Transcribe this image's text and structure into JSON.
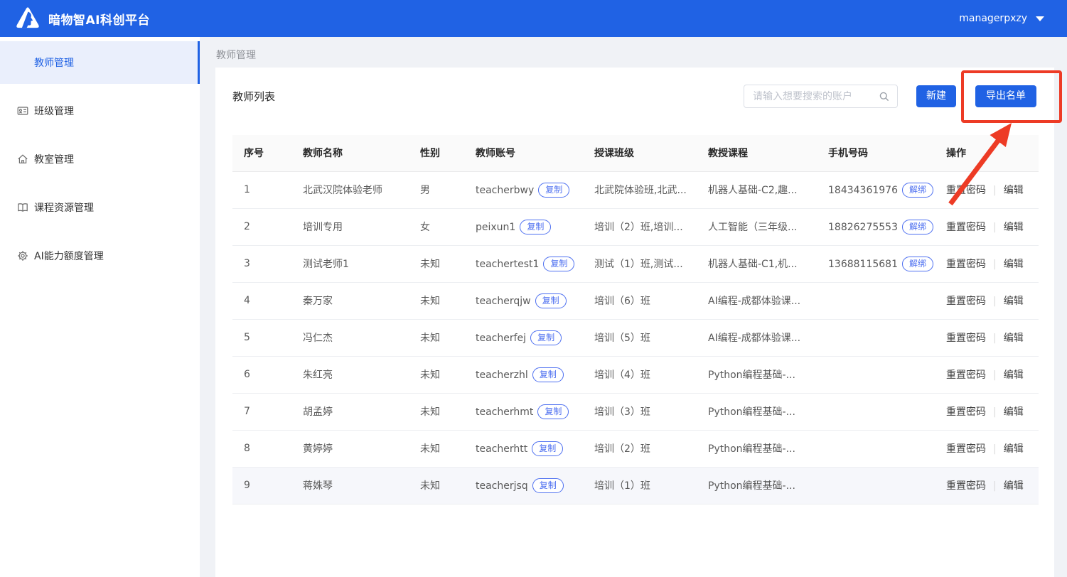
{
  "topbar": {
    "brand": "暗物智AI科创平台",
    "username": "managerpxzy"
  },
  "sidebar": {
    "items": [
      {
        "label": "教师管理",
        "active": true
      },
      {
        "label": "班级管理",
        "active": false
      },
      {
        "label": "教室管理",
        "active": false
      },
      {
        "label": "课程资源管理",
        "active": false
      },
      {
        "label": "AI能力额度管理",
        "active": false
      }
    ]
  },
  "breadcrumb": "教师管理",
  "page": {
    "title": "教师列表",
    "search_placeholder": "请输入想要搜索的账户",
    "new_button": "新建",
    "export_button": "导出名单"
  },
  "table": {
    "columns": [
      "序号",
      "教师名称",
      "性别",
      "教师账号",
      "授课班级",
      "教授课程",
      "手机号码",
      "操作"
    ],
    "copy_label": "复制",
    "unbind_label": "解绑",
    "action_reset": "重置密码",
    "action_edit": "编辑",
    "rows": [
      {
        "no": "1",
        "name": "北武汉院体验老师",
        "gender": "男",
        "account": "teacherbwy",
        "classes": "北武院体验班,北武...",
        "courses": "机器人基础-C2,趣...",
        "phone": "18434361976",
        "highlighted": false
      },
      {
        "no": "2",
        "name": "培训专用",
        "gender": "女",
        "account": "peixun1",
        "classes": "培训（2）班,培训...",
        "courses": "人工智能（三年级...",
        "phone": "18826275553",
        "highlighted": false
      },
      {
        "no": "3",
        "name": "测试老师1",
        "gender": "未知",
        "account": "teachertest1",
        "classes": "测试（1）班,测试...",
        "courses": "机器人基础-C1,机...",
        "phone": "13688115681",
        "highlighted": false
      },
      {
        "no": "4",
        "name": "秦万家",
        "gender": "未知",
        "account": "teacherqjw",
        "classes": "培训（6）班",
        "courses": "AI编程-成都体验课...",
        "phone": "",
        "highlighted": false
      },
      {
        "no": "5",
        "name": "冯仁杰",
        "gender": "未知",
        "account": "teacherfej",
        "classes": "培训（5）班",
        "courses": "AI编程-成都体验课...",
        "phone": "",
        "highlighted": false
      },
      {
        "no": "6",
        "name": "朱红亮",
        "gender": "未知",
        "account": "teacherzhl",
        "classes": "培训（4）班",
        "courses": "Python编程基础-...",
        "phone": "",
        "highlighted": false
      },
      {
        "no": "7",
        "name": "胡孟婷",
        "gender": "未知",
        "account": "teacherhmt",
        "classes": "培训（3）班",
        "courses": "Python编程基础-...",
        "phone": "",
        "highlighted": false
      },
      {
        "no": "8",
        "name": "黄婷婷",
        "gender": "未知",
        "account": "teacherhtt",
        "classes": "培训（2）班",
        "courses": "Python编程基础-...",
        "phone": "",
        "highlighted": false
      },
      {
        "no": "9",
        "name": "蒋姝琴",
        "gender": "未知",
        "account": "teacherjsq",
        "classes": "培训（1）班",
        "courses": "Python编程基础-...",
        "phone": "",
        "highlighted": true
      }
    ]
  },
  "colors": {
    "primary_blue": "#2062E4",
    "pill_blue": "#4D6FF0",
    "annotation_red": "#ED3B25"
  }
}
